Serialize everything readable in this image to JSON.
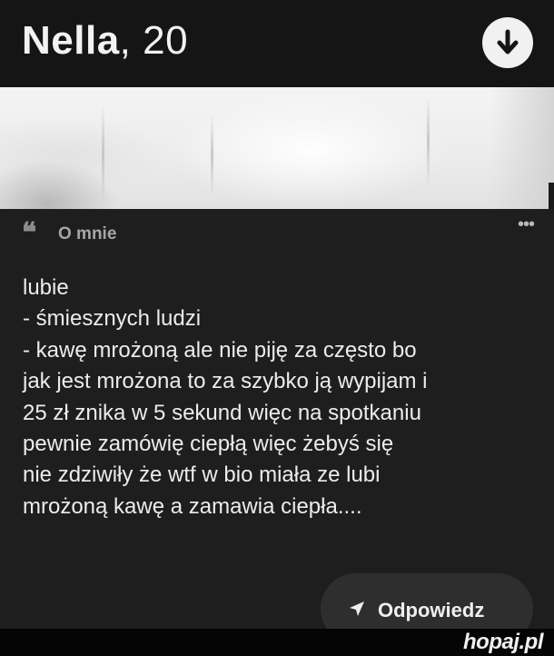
{
  "profile": {
    "name": "Nella",
    "separator": ",",
    "age": "20"
  },
  "about": {
    "title": "O mnie",
    "quote_icon": "quote-icon",
    "bio_lines": [
      "lubie",
      "-  śmiesznych ludzi",
      "- kawę mrożoną ale nie piję za często bo",
      "jak jest mrożona to za szybko ją wypijam i",
      "25 zł znika w 5 sekund więc na spotkaniu",
      "pewnie zamówię ciepłą więc żebyś się",
      "nie zdziwiły że wtf w bio miała ze lubi",
      "mrożoną kawę a zamawia ciepła...."
    ]
  },
  "actions": {
    "reply_label": "Odpowiedz"
  },
  "watermark": "hopaj.pl",
  "colors": {
    "background": "#161616",
    "card": "#1e1e1e",
    "button": "#2e2e2e",
    "text": "#ececec"
  }
}
